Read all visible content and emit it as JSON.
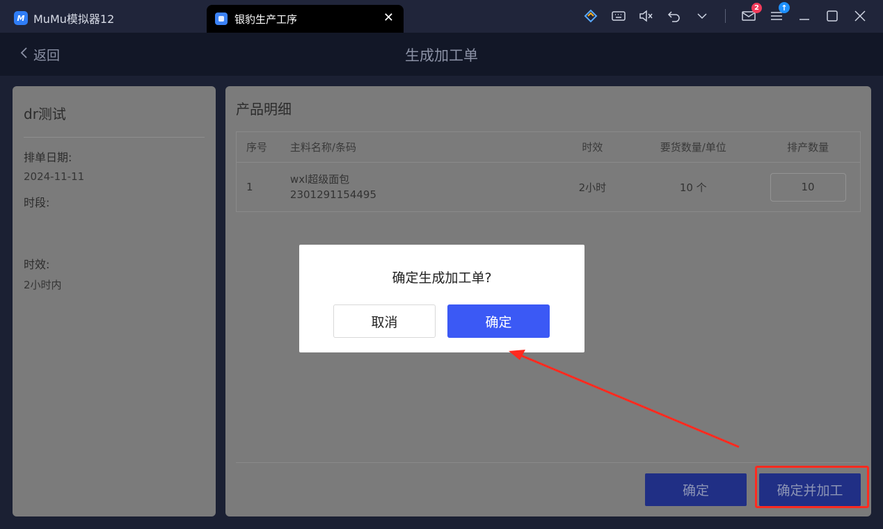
{
  "window": {
    "emulator_tab": "MuMu模拟器12",
    "app_tab": "银豹生产工序",
    "mail_badge": "2"
  },
  "header": {
    "back_label": "返回",
    "title": "生成加工单"
  },
  "order": {
    "name": "dr测试",
    "date_label": "排单日期:",
    "date_value": "2024-11-11",
    "period_label": "时段:",
    "period_value": "",
    "timeliness_label": "时效:",
    "timeliness_value": "2小时内"
  },
  "detail": {
    "section_title": "产品明细",
    "columns": [
      "序号",
      "主料名称/条码",
      "时效",
      "要货数量/单位",
      "排产数量"
    ],
    "rows": [
      {
        "index": "1",
        "name": "wxl超级面包",
        "barcode": "2301291154495",
        "timeliness": "2小时",
        "request_qty": "10 个",
        "schedule_qty": "10"
      }
    ]
  },
  "footer": {
    "confirm_label": "确定",
    "confirm_process_label": "确定并加工"
  },
  "dialog": {
    "message": "确定生成加工单?",
    "cancel_label": "取消",
    "ok_label": "确定"
  },
  "colors": {
    "accent": "#3b59f5",
    "annotation": "#ff2a1f"
  }
}
